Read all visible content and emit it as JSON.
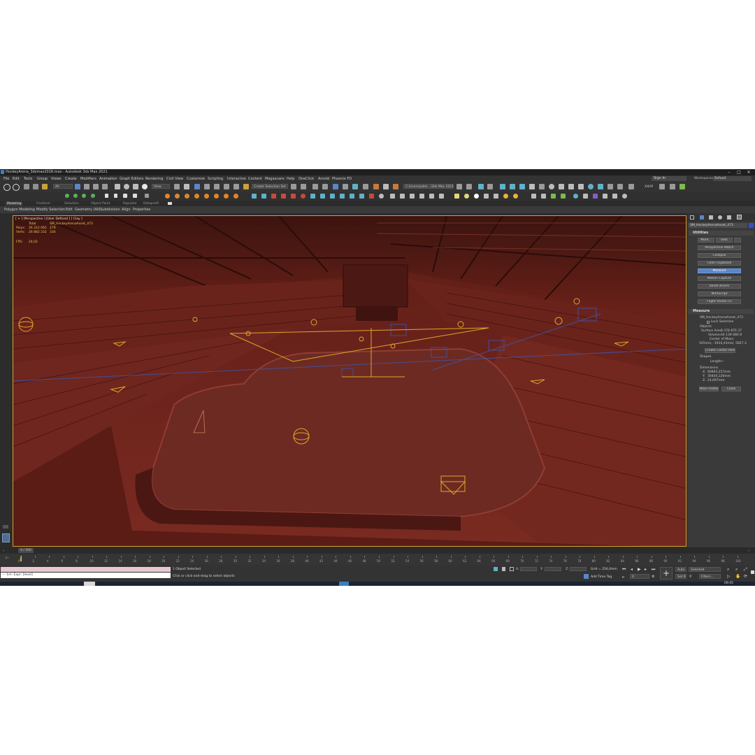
{
  "titlebar": {
    "title": "HockeyArena_3dsmax2018.max - Autodesk 3ds Max 2021",
    "minimize": "–",
    "maximize": "□",
    "close": "✕"
  },
  "menubar": {
    "items": [
      "File",
      "Edit",
      "Tools",
      "Group",
      "Views",
      "Create",
      "Modifiers",
      "Animation",
      "Graph Editors",
      "Rendering",
      "Civil View",
      "Customize",
      "Scripting",
      "Interactive",
      "Content",
      "Megascans",
      "Help",
      "OneClick",
      "Arnold",
      "Phoenix FD"
    ],
    "signin": "Sign In",
    "workspace_label": "Workspaces:",
    "workspace_value": "Default"
  },
  "toolbar": {
    "filter": "All",
    "view": "View",
    "selection_set": "Create Selection Set",
    "path": "C:\\Users\\admi...\\3ds Max 2021",
    "xview": "XXHP"
  },
  "ribbon": {
    "tabs": [
      "Modeling",
      "Freeform",
      "Selection",
      "Object Paint",
      "Populate",
      "Dataprofil"
    ],
    "sub_items": [
      "Polygon Modeling",
      "Modify Selection",
      "Edit",
      "Geometry (All)",
      "Subdivision",
      "Align",
      "Properties"
    ]
  },
  "viewport": {
    "label": "[ + ] [Perspective ] [User Defined ] [ Clay ]",
    "stats": {
      "header_total": "Total",
      "header_object": "SM_HockeyArenaAsset_473",
      "polys_label": "Polys:",
      "polys_total": "26 312 065",
      "polys_obj": "279",
      "verts_label": "Verts:",
      "verts_total": "26 882 232",
      "verts_obj": "334",
      "fps_label": "FPS:",
      "fps_value": "24,02"
    }
  },
  "command_panel": {
    "object_name": "SM_HockeyArenaAsset_473",
    "utilities": {
      "header": "Utilities",
      "more": "More...",
      "sets": "Sets",
      "buttons": [
        "Perspective Match",
        "Collapse",
        "Color Clipboard",
        "Measure",
        "Motion Capture",
        "Reset XForm",
        "MAXScript",
        "Flight Studio (c)"
      ]
    },
    "measure": {
      "header": "Measure",
      "object_name": "SM_HockeyArenaAsset_473",
      "lock_selection": "Lock Selection",
      "objects_label": "Objects",
      "surface_area_label": "Surface Area:",
      "surface_area": "3 378 876 37",
      "volume_label": "Volume:",
      "volume": "44 139 080 8",
      "center_of_mass_label": "Center of Mass:",
      "center_of_mass": "545mm, -1914,43mm, 5827,3",
      "create_center_point": "Create Center Point",
      "shapes_label": "Shapes",
      "length_label": "Length:",
      "length": "---",
      "dimensions_label": "Dimensions",
      "x_label": "X:",
      "x": "60893,257mm",
      "y_label": "Y:",
      "y": "30404,126mm",
      "z_label": "Z:",
      "z": "24,697mm",
      "new_floater": "New Floater",
      "close": "Close"
    }
  },
  "timeline": {
    "frame": "0 / 100",
    "ticks": [
      "0",
      "2",
      "4",
      "6",
      "8",
      "10",
      "12",
      "14",
      "16",
      "18",
      "20",
      "22",
      "24",
      "26",
      "28",
      "30",
      "32",
      "34",
      "36",
      "38",
      "40",
      "42",
      "44",
      "46",
      "48",
      "50",
      "52",
      "54",
      "56",
      "58",
      "60",
      "62",
      "64",
      "66",
      "68",
      "70",
      "72",
      "74",
      "76",
      "78",
      "80",
      "82",
      "84",
      "86",
      "88",
      "90",
      "92",
      "94",
      "96",
      "98",
      "100"
    ]
  },
  "status": {
    "maxscript_line": "--- 1m: Expr: [level]",
    "selection": "1 Object Selected",
    "prompt": "Click or click-and-drag to select objects",
    "x_label": "X:",
    "y_label": "Y:",
    "z_label": "Z:",
    "grid": "Grid = 254,0mm",
    "add_time_tag": "Add Time Tag",
    "auto": "Auto",
    "selected": "Selected",
    "set_k": "Set K.",
    "filters": "Filters...",
    "frame_field": "0",
    "clock": "09:45"
  },
  "colors": {
    "viewport_bg": "#4a1612",
    "accent": "#d8a12a",
    "highlight": "#5a86c9"
  }
}
